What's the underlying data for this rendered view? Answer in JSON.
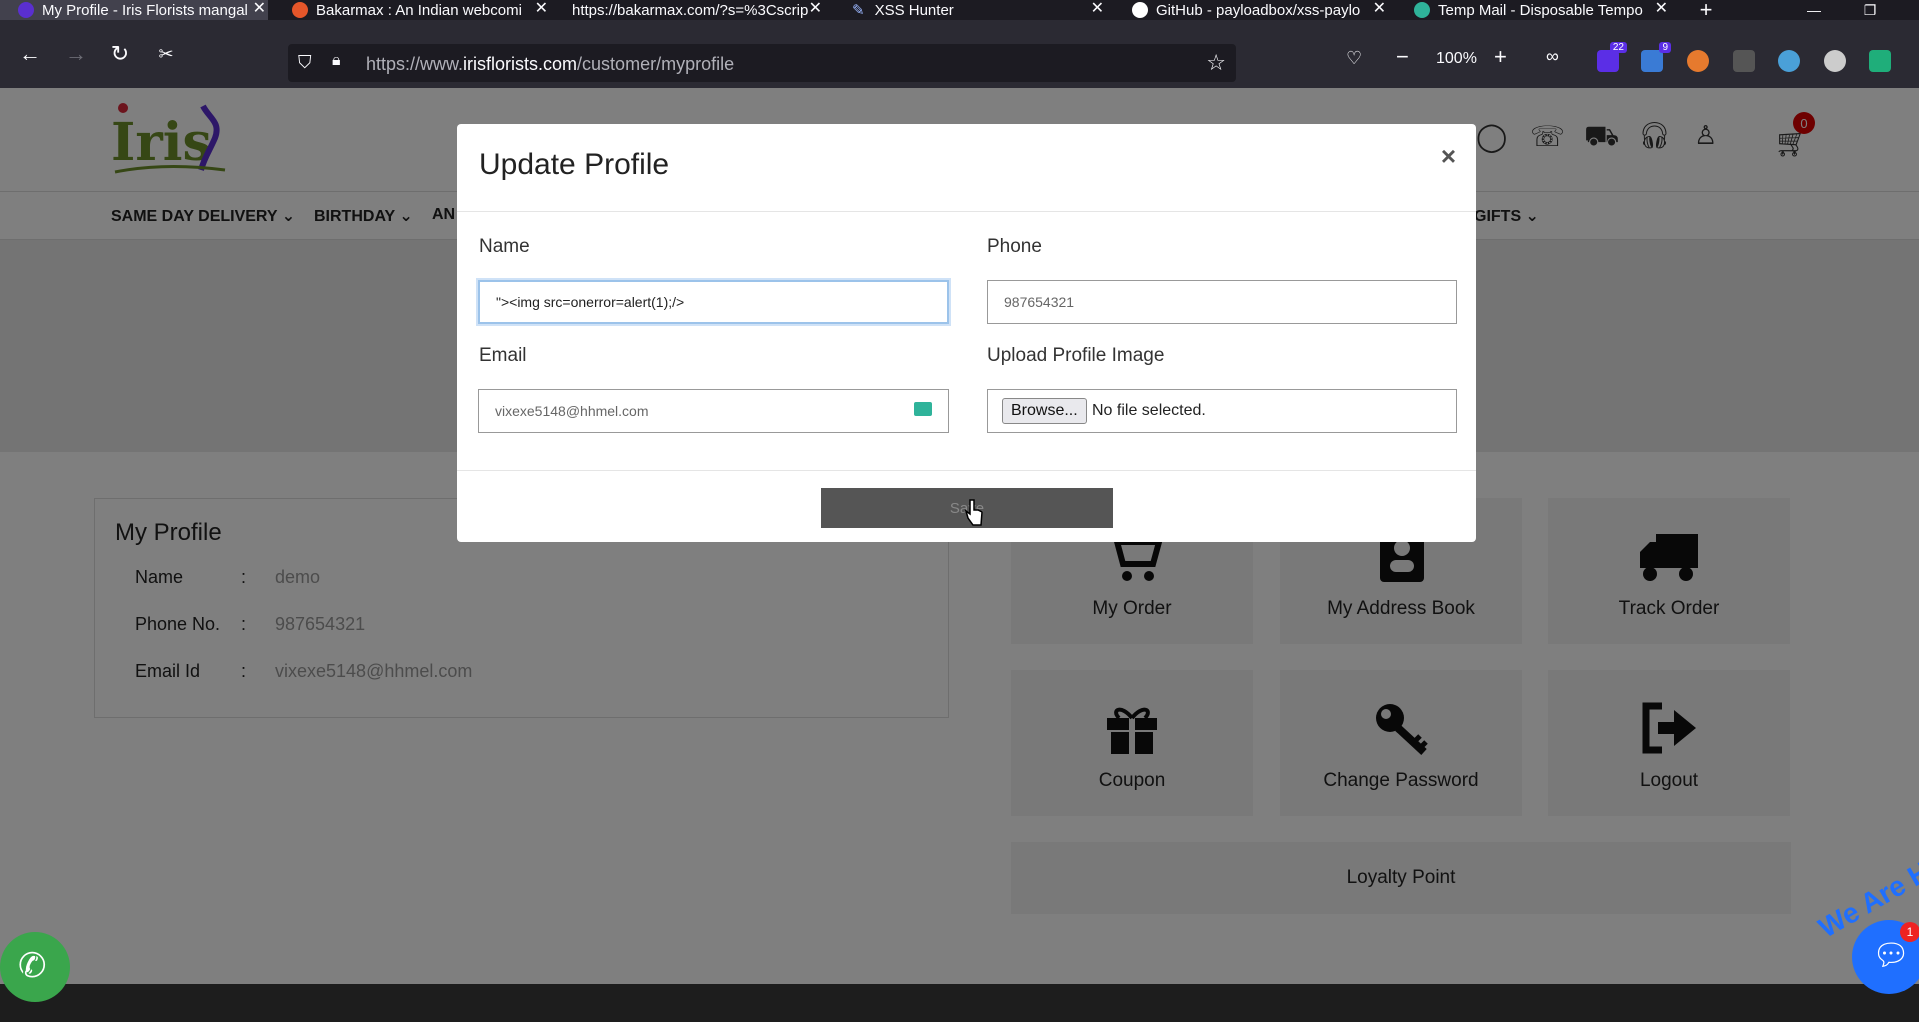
{
  "browser": {
    "tabs": [
      {
        "title": "My Profile - Iris Florists mangal",
        "active": true,
        "favicon_color": "#5a2fd0"
      },
      {
        "title": "Bakarmax : An Indian webcomi",
        "active": false,
        "favicon_color": "#e5562a"
      },
      {
        "title": "https://bakarmax.com/?s=%3Cscrip",
        "active": false,
        "favicon_color": ""
      },
      {
        "title": "XSS Hunter",
        "active": false,
        "favicon_color": "#9bb7ff"
      },
      {
        "title": "GitHub - payloadbox/xss-paylo",
        "active": false,
        "favicon_color": "#ffffff"
      },
      {
        "title": "Temp Mail - Disposable Tempo",
        "active": false,
        "favicon_color": "#2fb39a"
      }
    ],
    "url_prefix": "https://www.",
    "url_host": "irisflorists.com",
    "url_path": "/customer/myprofile",
    "zoom": "100%",
    "extension_badges": {
      "ext1": "22",
      "ext2": "9"
    }
  },
  "site": {
    "cart_count": "0",
    "menu": [
      "SAME DAY DELIVERY",
      "BIRTHDAY",
      "AN",
      "GIFTS"
    ],
    "profile": {
      "title": "My Profile",
      "rows": [
        {
          "label": "Name",
          "value": "demo"
        },
        {
          "label": "Phone No.",
          "value": "987654321"
        },
        {
          "label": "Email Id",
          "value": "vixexe5148@hhmel.com"
        }
      ]
    },
    "tiles": [
      {
        "label": "My Order",
        "icon": "cart-icon"
      },
      {
        "label": "My Address Book",
        "icon": "address-book-icon"
      },
      {
        "label": "Track Order",
        "icon": "truck-icon"
      },
      {
        "label": "Coupon",
        "icon": "gift-icon"
      },
      {
        "label": "Change Password",
        "icon": "key-icon"
      },
      {
        "label": "Logout",
        "icon": "logout-icon"
      }
    ],
    "loyalty_label": "Loyalty Point",
    "chat_badge": "1",
    "chat_tagline": "We Are He"
  },
  "modal": {
    "title": "Update Profile",
    "close": "×",
    "name_label": "Name",
    "name_value": "\"><img src=onerror=alert(1);/>",
    "phone_label": "Phone",
    "phone_value": "987654321",
    "email_label": "Email",
    "email_value": "vixexe5148@hhmel.com",
    "upload_label": "Upload Profile Image",
    "browse_label": "Browse...",
    "no_file": "No file selected.",
    "save_label": "Save"
  },
  "colors": {
    "brand_purple": "#5a2fd0",
    "whatsapp_green": "#3aa64c",
    "chat_blue": "#1f6fff"
  }
}
